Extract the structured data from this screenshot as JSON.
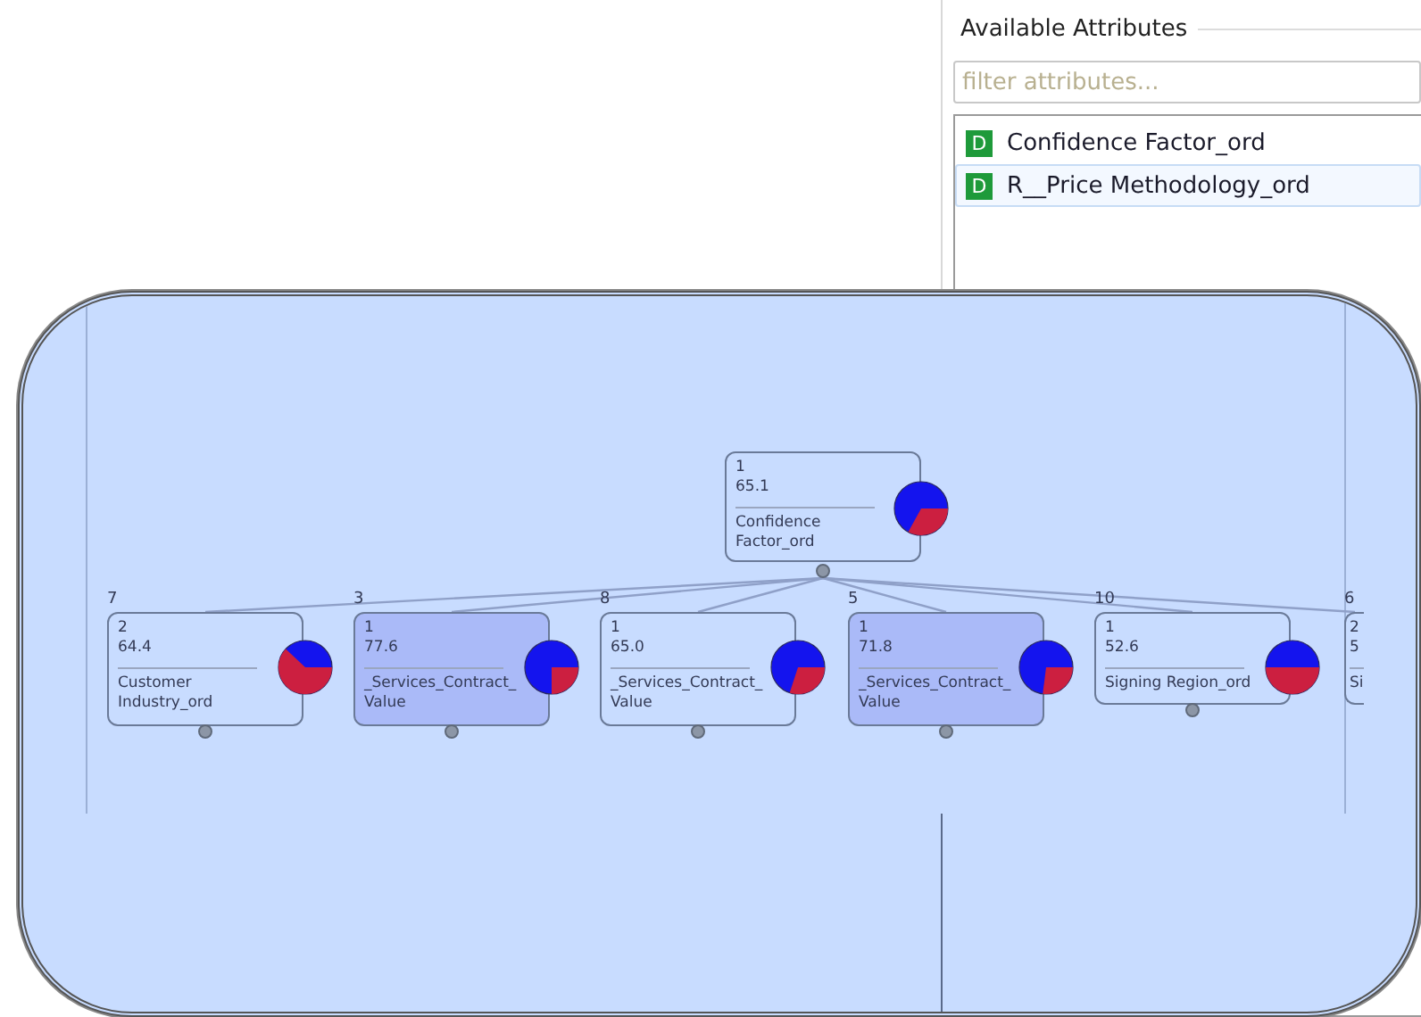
{
  "attributes_panel": {
    "title": "Available Attributes",
    "filter": {
      "placeholder": "filter attributes..."
    },
    "items": [
      {
        "badge": "D",
        "label": "Confidence Factor_ord",
        "selected": false
      },
      {
        "badge": "D",
        "label": "R__Price Methodology_ord",
        "selected": true
      }
    ]
  },
  "tree": {
    "root": {
      "count": "1",
      "value": "65.1",
      "label_lines": [
        "Confidence",
        "Factor_ord"
      ]
    },
    "children": [
      {
        "kind": "full",
        "number": "7",
        "count": "2",
        "value": "64.4",
        "label_lines": [
          "Customer",
          "Industry_ord"
        ],
        "selected": false
      },
      {
        "kind": "full",
        "number": "3",
        "count": "1",
        "value": "77.6",
        "label_lines": [
          "_Services_Contract_",
          "Value"
        ],
        "selected": true
      },
      {
        "kind": "full",
        "number": "8",
        "count": "1",
        "value": "65.0",
        "label_lines": [
          "_Services_Contract_",
          "Value"
        ],
        "selected": false
      },
      {
        "kind": "full",
        "number": "5",
        "count": "1",
        "value": "71.8",
        "label_lines": [
          "_Services_Contract_",
          "Value"
        ],
        "selected": true
      },
      {
        "kind": "full",
        "number": "10",
        "count": "1",
        "value": "52.6",
        "label_lines": [
          "Signing Region_ord"
        ],
        "selected": false
      },
      {
        "kind": "partial",
        "number": "6",
        "count": "2",
        "value": "5",
        "label_lines": [
          "Si"
        ]
      }
    ]
  }
}
